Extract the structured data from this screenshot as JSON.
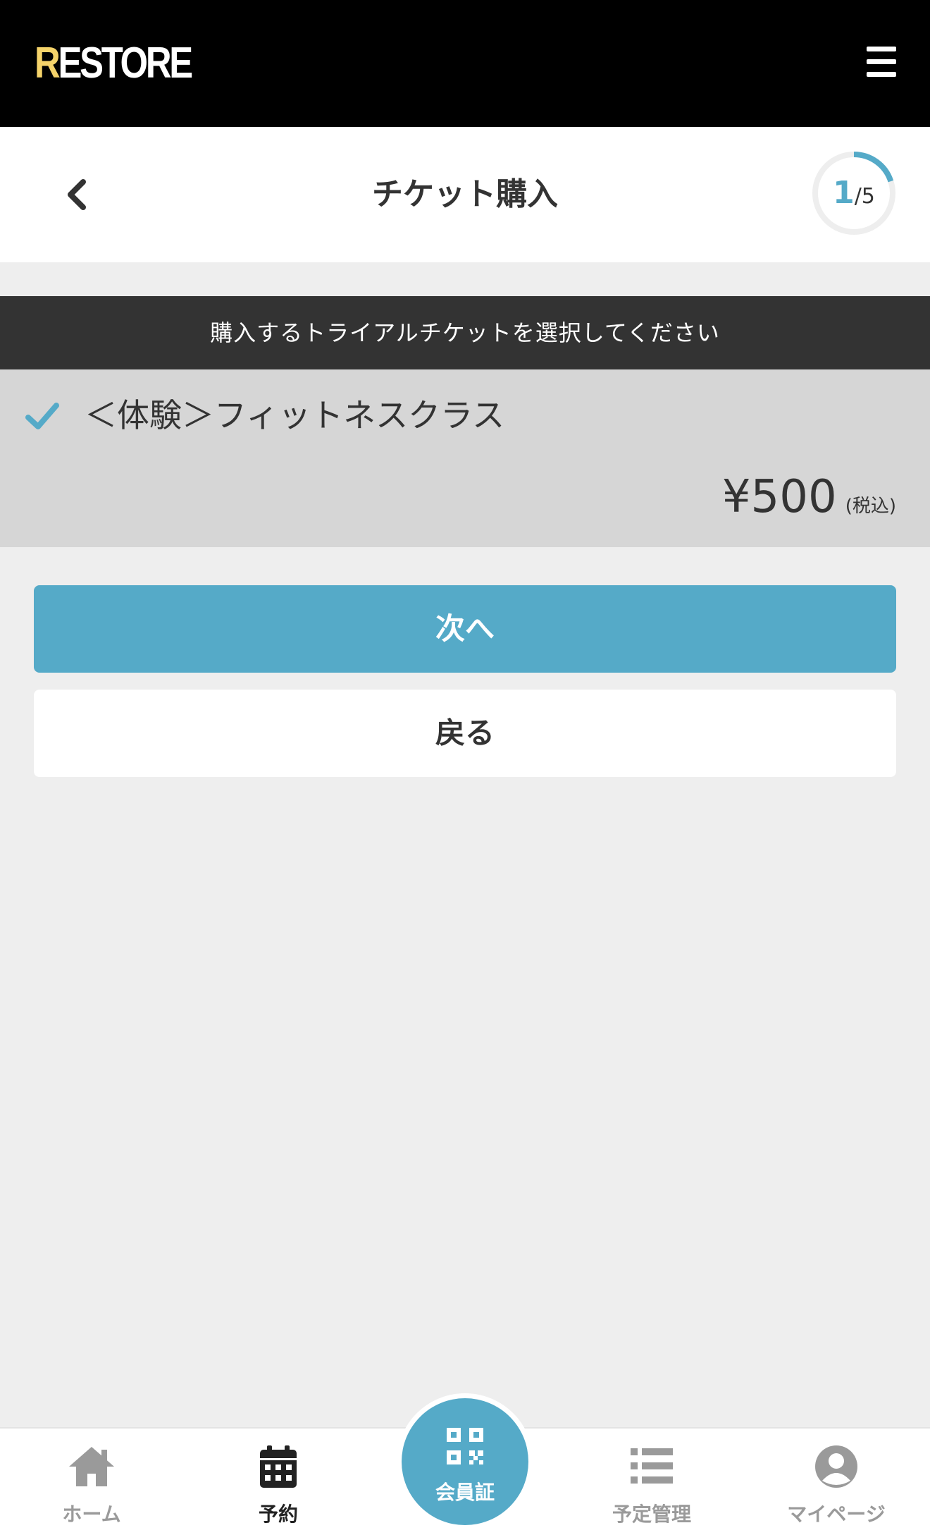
{
  "header": {
    "logo_first": "R",
    "logo_rest": "ESTORE",
    "menu_icon": "hamburger-menu-icon"
  },
  "title_bar": {
    "back_icon": "chevron-left-icon",
    "title": "チケット購入",
    "step_current": "1",
    "step_total": "/5",
    "step_progress": 0.2
  },
  "instruction": "購入するトライアルチケットを選択してください",
  "ticket": {
    "selected": true,
    "check_icon": "checkmark-icon",
    "name": "＜体験＞フィットネスクラス",
    "price": "¥500",
    "tax_note": "(税込)"
  },
  "buttons": {
    "next": "次へ",
    "back": "戻る"
  },
  "bottom_nav": {
    "items": [
      {
        "label": "ホーム",
        "icon": "home-icon",
        "active": false
      },
      {
        "label": "予約",
        "icon": "calendar-icon",
        "active": true
      },
      {
        "label": "会員証",
        "icon": "qr-code-icon",
        "active": false
      },
      {
        "label": "予定管理",
        "icon": "list-icon",
        "active": false
      },
      {
        "label": "マイページ",
        "icon": "user-icon",
        "active": false
      }
    ]
  },
  "colors": {
    "accent": "#55aac8",
    "header_bg": "#000000",
    "logo_accent": "#f5d36a",
    "banner_bg": "#333333",
    "selected_bg": "#d6d6d6",
    "page_bg": "#eeeeee"
  }
}
